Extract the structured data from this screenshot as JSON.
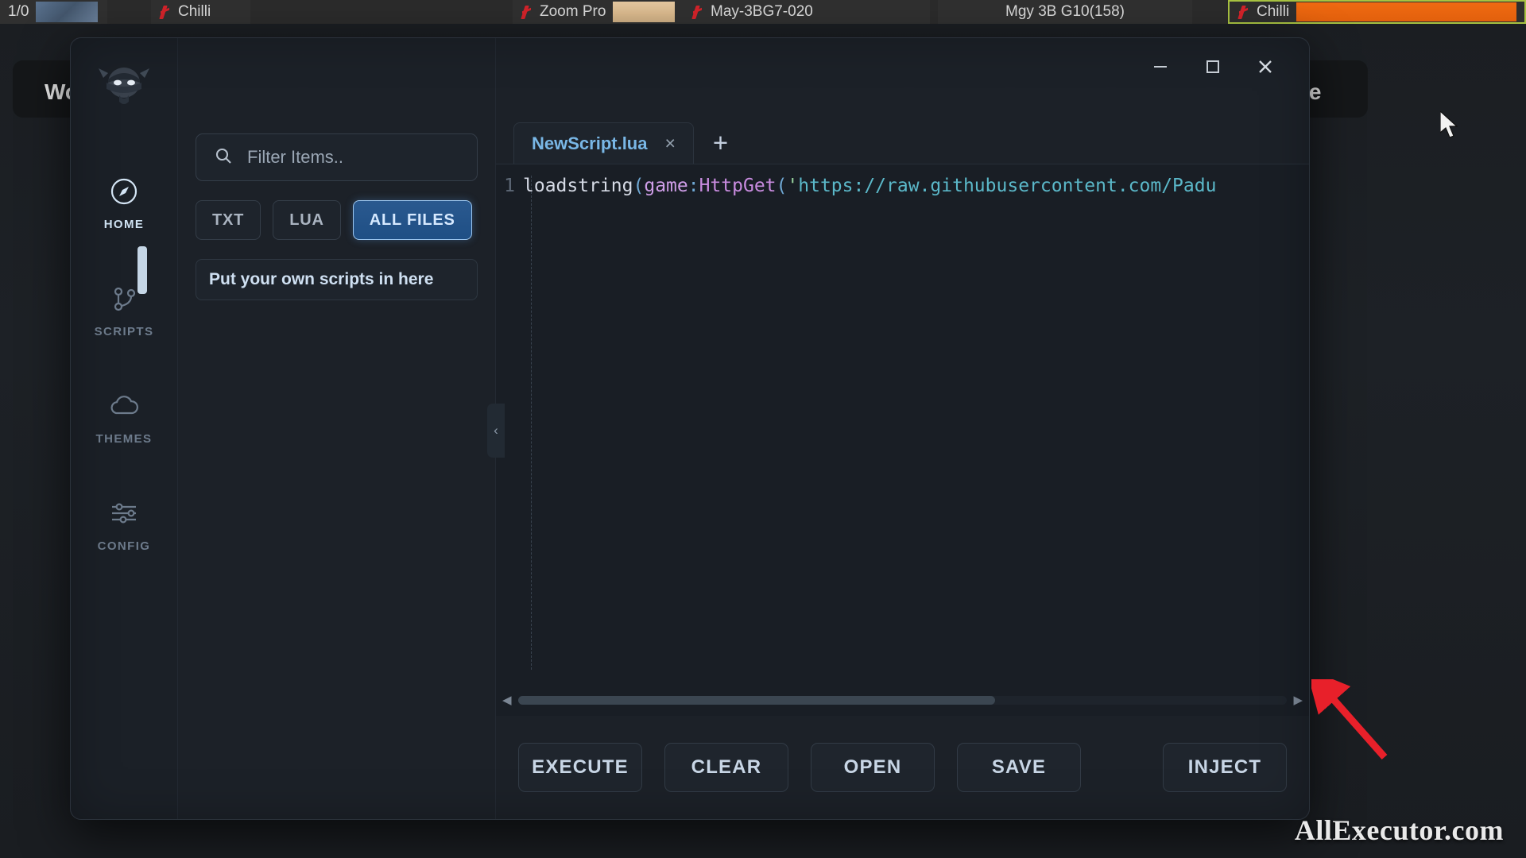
{
  "taskbar": {
    "items": [
      {
        "label": "1/0",
        "icon": "",
        "thumb": "blue"
      },
      {
        "label": "Chilli",
        "icon": "chilli-icon",
        "thumb": ""
      },
      {
        "label": "Zoom Pro",
        "icon": "chilli-icon",
        "thumb": "tan"
      },
      {
        "label": "May-3BG7-020",
        "icon": "chilli-icon",
        "thumb": ""
      },
      {
        "label": "Mgy 3B G10(158)",
        "icon": "",
        "thumb": ""
      },
      {
        "label": "Chilli",
        "icon": "chilli-icon",
        "thumb": "orange"
      }
    ]
  },
  "background_app": {
    "left_text": "Wo",
    "right_text": "re"
  },
  "window": {
    "controls": {
      "minimize": "minimize-button",
      "maximize": "maximize-button",
      "close": "close-button"
    },
    "sidebar": {
      "logo": "ninja-logo",
      "items": [
        {
          "label": "HOME",
          "icon": "compass-icon",
          "active": true
        },
        {
          "label": "SCRIPTS",
          "icon": "git-branch-icon",
          "active": false
        },
        {
          "label": "THEMES",
          "icon": "cloud-icon",
          "active": false
        },
        {
          "label": "CONFIG",
          "icon": "sliders-icon",
          "active": false
        }
      ]
    },
    "files_panel": {
      "filter": {
        "icon": "search-icon",
        "value": "",
        "placeholder": "Filter Items.."
      },
      "type_filters": [
        {
          "label": "TXT",
          "active": false
        },
        {
          "label": "LUA",
          "active": false
        },
        {
          "label": "ALL FILES",
          "active": true
        }
      ],
      "scripts": [
        {
          "label": "Put your own scripts in here"
        }
      ],
      "collapse_handle": "‹"
    },
    "editor": {
      "tabs": [
        {
          "label": "NewScript.lua",
          "close": "×",
          "active": true
        }
      ],
      "add_tab": "+",
      "line_number": "1",
      "code_tokens": [
        {
          "text": "loadstring",
          "type": "fn"
        },
        {
          "text": "(",
          "type": "punc"
        },
        {
          "text": "game",
          "type": "kw"
        },
        {
          "text": ":",
          "type": "punc"
        },
        {
          "text": "HttpGet",
          "type": "prop"
        },
        {
          "text": "(",
          "type": "punc"
        },
        {
          "text": "'",
          "type": "q"
        },
        {
          "text": "https://raw.githubusercontent.com/Padu",
          "type": "str"
        }
      ],
      "code_plain": "loadstring(game:HttpGet('https://raw.githubusercontent.com/Padu",
      "scrollbar": {
        "left_arrow": "◀",
        "right_arrow": "▶"
      }
    },
    "actions": [
      {
        "label": "EXECUTE"
      },
      {
        "label": "CLEAR"
      },
      {
        "label": "OPEN"
      },
      {
        "label": "SAVE"
      },
      {
        "label": "INJECT"
      }
    ]
  },
  "watermark": "AllExecutor.com",
  "colors": {
    "accent_blue": "#2a598f",
    "tab_blue": "#79b7e6",
    "panel_bg": "#1c2128",
    "sidebar_bg": "#1b2027",
    "code_bg": "#191e25",
    "red_arrow": "#e8202a",
    "taskbar_selected_border": "#a8c241"
  }
}
